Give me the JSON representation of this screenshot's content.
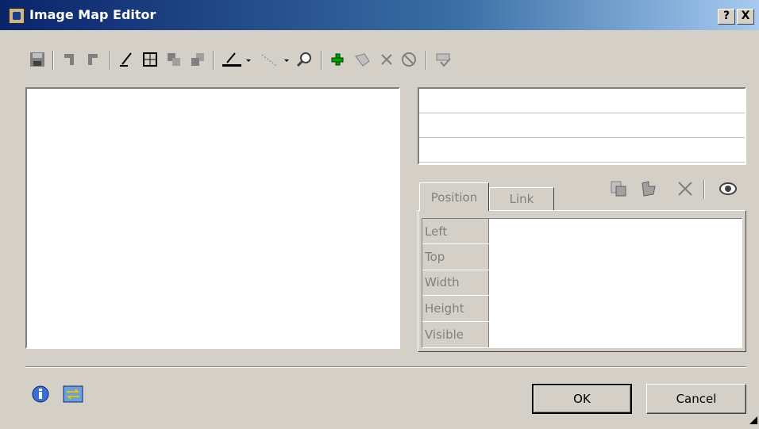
{
  "window": {
    "title": "Image Map Editor",
    "help_label": "?",
    "close_label": "X"
  },
  "toolbar": {
    "icons": [
      "save-icon",
      "undo-icon",
      "redo-icon",
      "pencil-icon",
      "rectangle-edit-icon",
      "bring-forward-icon",
      "send-backward-icon",
      "line-color-icon",
      "line-style-icon",
      "zoom-icon",
      "add-icon",
      "edit-hotspot-icon",
      "delete-icon",
      "cancel-icon",
      "test-icon"
    ]
  },
  "hotspot_list": {
    "rows": [
      "",
      "",
      ""
    ]
  },
  "tabs": [
    {
      "label": "Position",
      "active": true
    },
    {
      "label": "Link",
      "active": false
    }
  ],
  "properties": {
    "rows": [
      {
        "label": "Left",
        "value": ""
      },
      {
        "label": "Top",
        "value": ""
      },
      {
        "label": "Width",
        "value": ""
      },
      {
        "label": "Height",
        "value": ""
      },
      {
        "label": "Visible",
        "value": ""
      }
    ]
  },
  "buttons": {
    "ok": "OK",
    "cancel": "Cancel"
  },
  "colors": {
    "title_start": "#0a246a",
    "title_end": "#a6caf0",
    "face": "#d4d0c8",
    "add_green": "#00a000"
  }
}
